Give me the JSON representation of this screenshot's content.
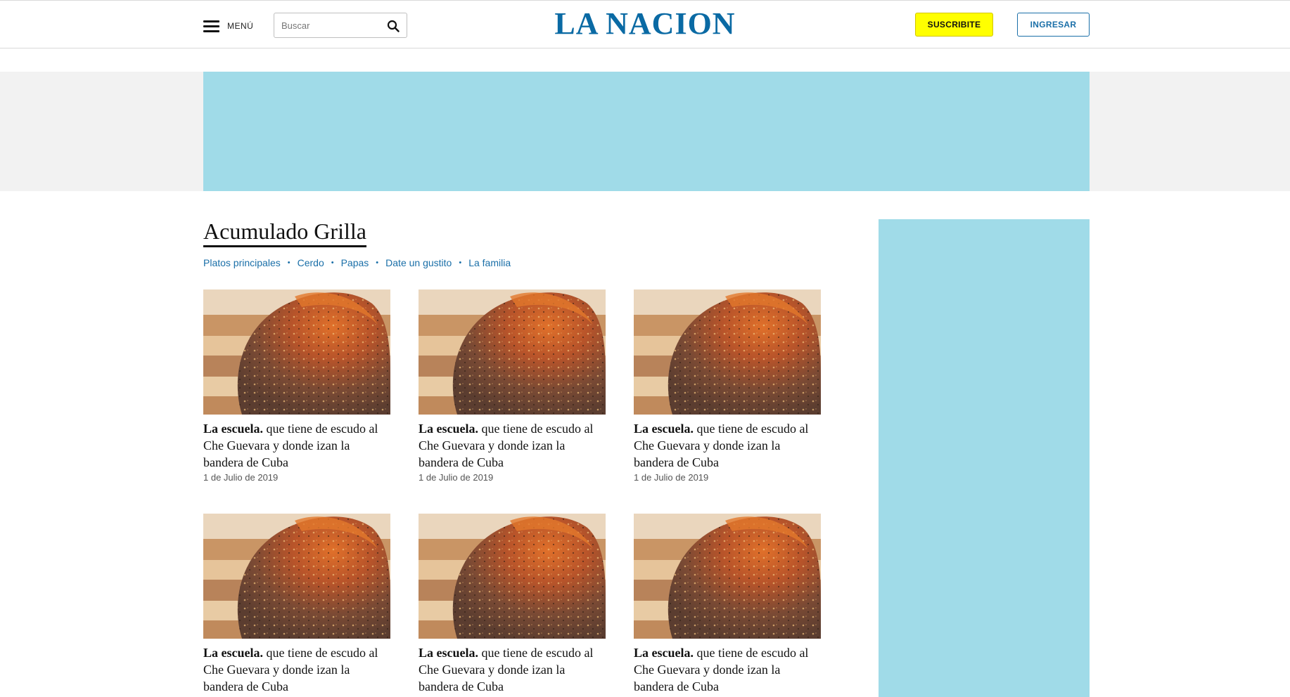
{
  "header": {
    "menu_label": "MENÚ",
    "search_placeholder": "Buscar",
    "logo": "LA NACION",
    "subscribe_label": "SUSCRIBITE",
    "login_label": "INGRESAR"
  },
  "section": {
    "title": "Acumulado Grilla",
    "tags": [
      "Platos principales",
      "Cerdo",
      "Papas",
      "Date un gustito",
      "La familia"
    ]
  },
  "articles": [
    {
      "kicker": "La escuela.",
      "title": " que tiene de escudo al Che Guevara y donde izan la bandera de Cuba",
      "date": "1 de Julio de 2019"
    },
    {
      "kicker": "La escuela.",
      "title": " que tiene de escudo al Che Guevara y donde izan la bandera de Cuba",
      "date": "1 de Julio de 2019"
    },
    {
      "kicker": "La escuela.",
      "title": " que tiene de escudo al Che Guevara y donde izan la bandera de Cuba",
      "date": "1 de Julio de 2019"
    },
    {
      "kicker": "La escuela.",
      "title": " que tiene de escudo al Che Guevara y donde izan la bandera de Cuba",
      "date": ""
    },
    {
      "kicker": "La escuela.",
      "title": " que tiene de escudo al Che Guevara y donde izan la bandera de Cuba",
      "date": ""
    },
    {
      "kicker": "La escuela.",
      "title": " que tiene de escudo al Che Guevara y donde izan la bandera de Cuba",
      "date": ""
    }
  ],
  "colors": {
    "brand": "#0a6aa4",
    "link": "#1a6fa8",
    "subscribe_bg": "#ffff00",
    "ad_placeholder": "#a0dbe8"
  }
}
